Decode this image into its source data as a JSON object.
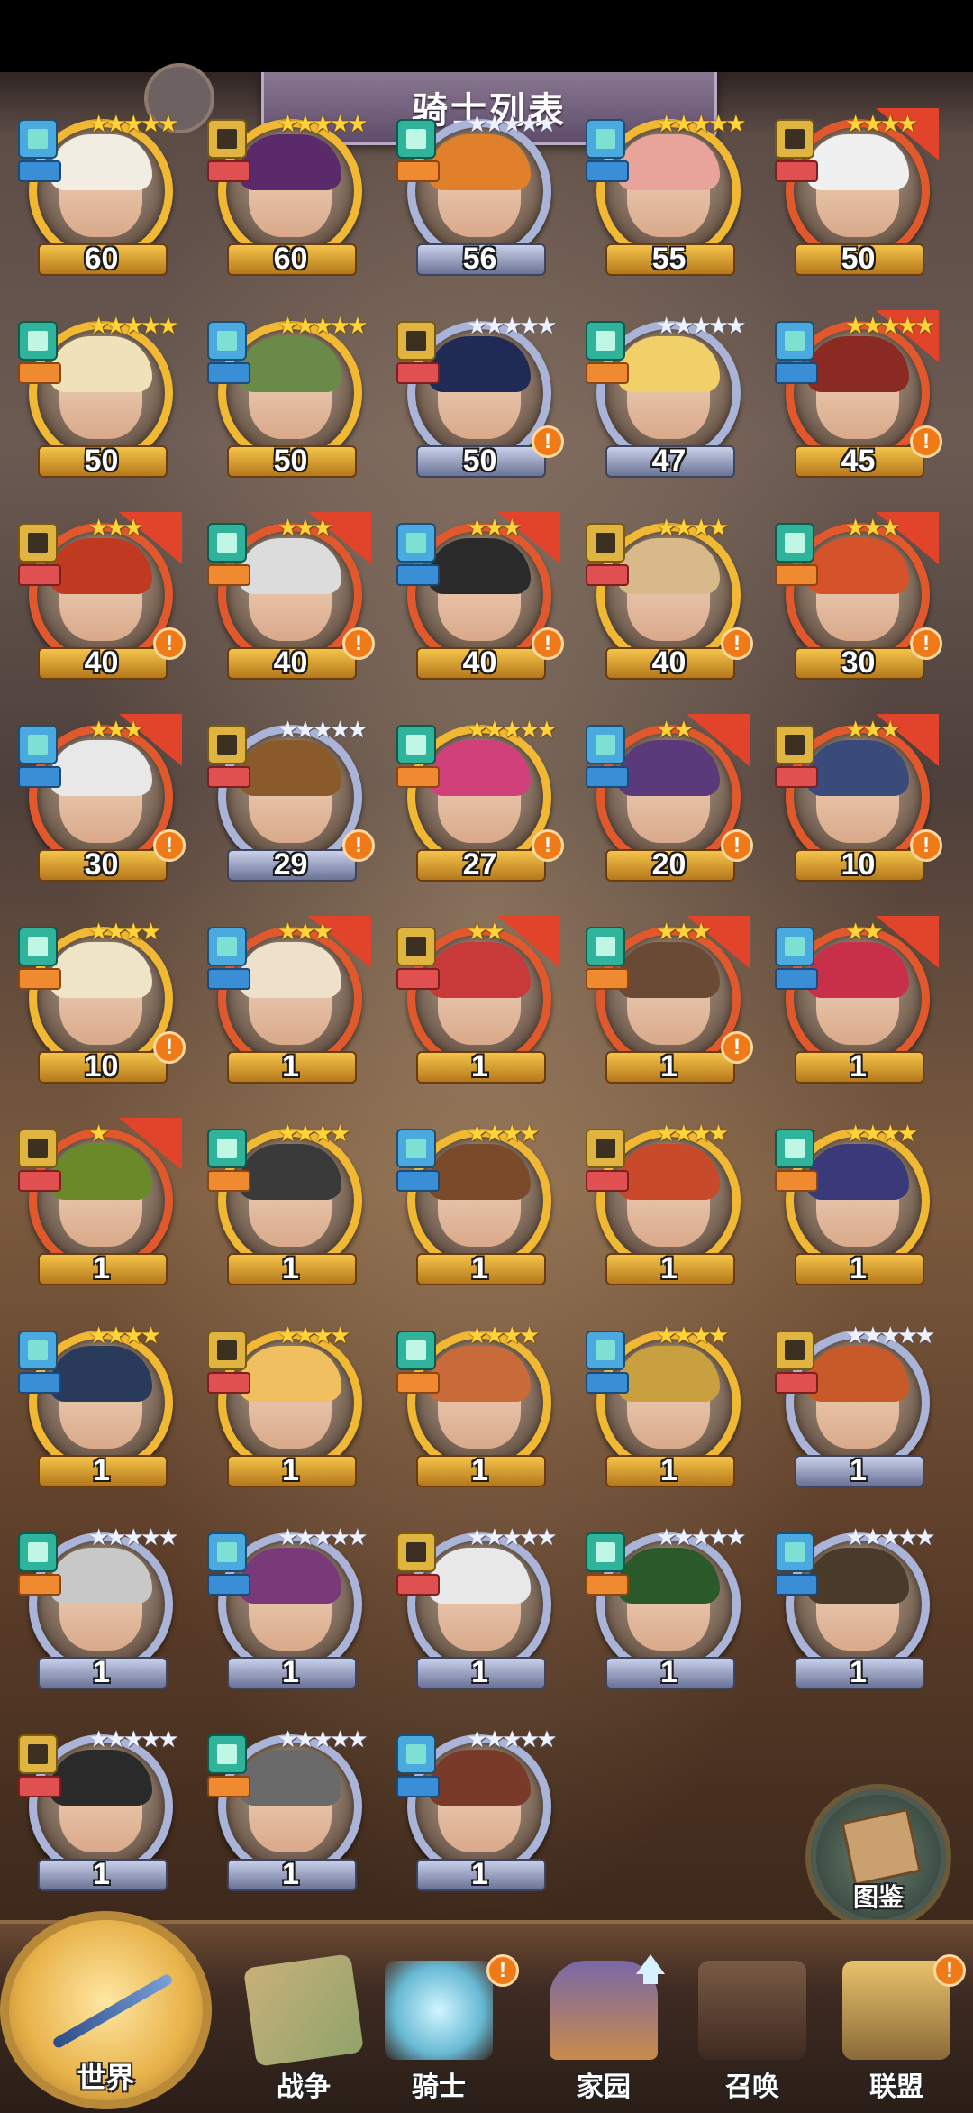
{
  "header": {
    "title": "骑士列表"
  },
  "knights": [
    {
      "level": "60",
      "stars": "★★★★★",
      "alert": false,
      "tier": "gold"
    },
    {
      "level": "60",
      "stars": "★★★★★",
      "alert": false,
      "tier": "gold"
    },
    {
      "level": "56",
      "stars": "★★★★★",
      "alert": false,
      "tier": "silver"
    },
    {
      "level": "55",
      "stars": "★★★★★",
      "alert": false,
      "tier": "gold"
    },
    {
      "level": "50",
      "stars": "★★★★",
      "alert": false,
      "tier": "red"
    },
    {
      "level": "50",
      "stars": "★★★★★",
      "alert": false,
      "tier": "gold"
    },
    {
      "level": "50",
      "stars": "★★★★★",
      "alert": false,
      "tier": "gold"
    },
    {
      "level": "50",
      "stars": "★★★★★",
      "alert": true,
      "tier": "silver"
    },
    {
      "level": "47",
      "stars": "★★★★★",
      "alert": false,
      "tier": "silver"
    },
    {
      "level": "45",
      "stars": "★★★★★",
      "alert": true,
      "tier": "red"
    },
    {
      "level": "40",
      "stars": "★★★",
      "alert": true,
      "tier": "red"
    },
    {
      "level": "40",
      "stars": "★★★",
      "alert": true,
      "tier": "red"
    },
    {
      "level": "40",
      "stars": "★★★",
      "alert": true,
      "tier": "red"
    },
    {
      "level": "40",
      "stars": "★★★★",
      "alert": true,
      "tier": "gold"
    },
    {
      "level": "30",
      "stars": "★★★",
      "alert": true,
      "tier": "red"
    },
    {
      "level": "30",
      "stars": "★★★",
      "alert": true,
      "tier": "red"
    },
    {
      "level": "29",
      "stars": "★★★★★",
      "alert": true,
      "tier": "silver"
    },
    {
      "level": "27",
      "stars": "★★★★★",
      "alert": true,
      "tier": "gold"
    },
    {
      "level": "20",
      "stars": "★★",
      "alert": true,
      "tier": "red"
    },
    {
      "level": "10",
      "stars": "★★★",
      "alert": true,
      "tier": "red"
    },
    {
      "level": "10",
      "stars": "★★★★",
      "alert": true,
      "tier": "gold"
    },
    {
      "level": "1",
      "stars": "★★★",
      "alert": false,
      "tier": "red"
    },
    {
      "level": "1",
      "stars": "★★",
      "alert": false,
      "tier": "red"
    },
    {
      "level": "1",
      "stars": "★★★",
      "alert": true,
      "tier": "red"
    },
    {
      "level": "1",
      "stars": "★★",
      "alert": false,
      "tier": "red"
    },
    {
      "level": "1",
      "stars": "★",
      "alert": false,
      "tier": "red"
    },
    {
      "level": "1",
      "stars": "★★★★",
      "alert": false,
      "tier": "gold"
    },
    {
      "level": "1",
      "stars": "★★★★",
      "alert": false,
      "tier": "gold"
    },
    {
      "level": "1",
      "stars": "★★★★",
      "alert": false,
      "tier": "gold"
    },
    {
      "level": "1",
      "stars": "★★★★",
      "alert": false,
      "tier": "gold"
    },
    {
      "level": "1",
      "stars": "★★★★",
      "alert": false,
      "tier": "gold"
    },
    {
      "level": "1",
      "stars": "★★★★",
      "alert": false,
      "tier": "gold"
    },
    {
      "level": "1",
      "stars": "★★★★",
      "alert": false,
      "tier": "gold"
    },
    {
      "level": "1",
      "stars": "★★★★",
      "alert": false,
      "tier": "gold"
    },
    {
      "level": "1",
      "stars": "★★★★★",
      "alert": false,
      "tier": "silver"
    },
    {
      "level": "1",
      "stars": "★★★★★",
      "alert": false,
      "tier": "silver"
    },
    {
      "level": "1",
      "stars": "★★★★★",
      "alert": false,
      "tier": "silver"
    },
    {
      "level": "1",
      "stars": "★★★★★",
      "alert": false,
      "tier": "silver"
    },
    {
      "level": "1",
      "stars": "★★★★★",
      "alert": false,
      "tier": "silver"
    },
    {
      "level": "1",
      "stars": "★★★★★",
      "alert": false,
      "tier": "silver"
    },
    {
      "level": "1",
      "stars": "★★★★★",
      "alert": false,
      "tier": "silver"
    },
    {
      "level": "1",
      "stars": "★★★★★",
      "alert": false,
      "tier": "silver"
    },
    {
      "level": "1",
      "stars": "★★★★★",
      "alert": false,
      "tier": "silver"
    }
  ],
  "codex": {
    "label": "图鉴"
  },
  "nav": {
    "world": "世界",
    "battle": "战争",
    "knights": "骑士",
    "home": "家园",
    "summon": "召唤",
    "alliance": "联盟",
    "alert_glyph": "!"
  },
  "colors": {
    "gold_ring": "#f1b833",
    "silver_ring": "#aab4d8",
    "alert": "#f07a18",
    "title_plate": "#6e5a7a"
  }
}
